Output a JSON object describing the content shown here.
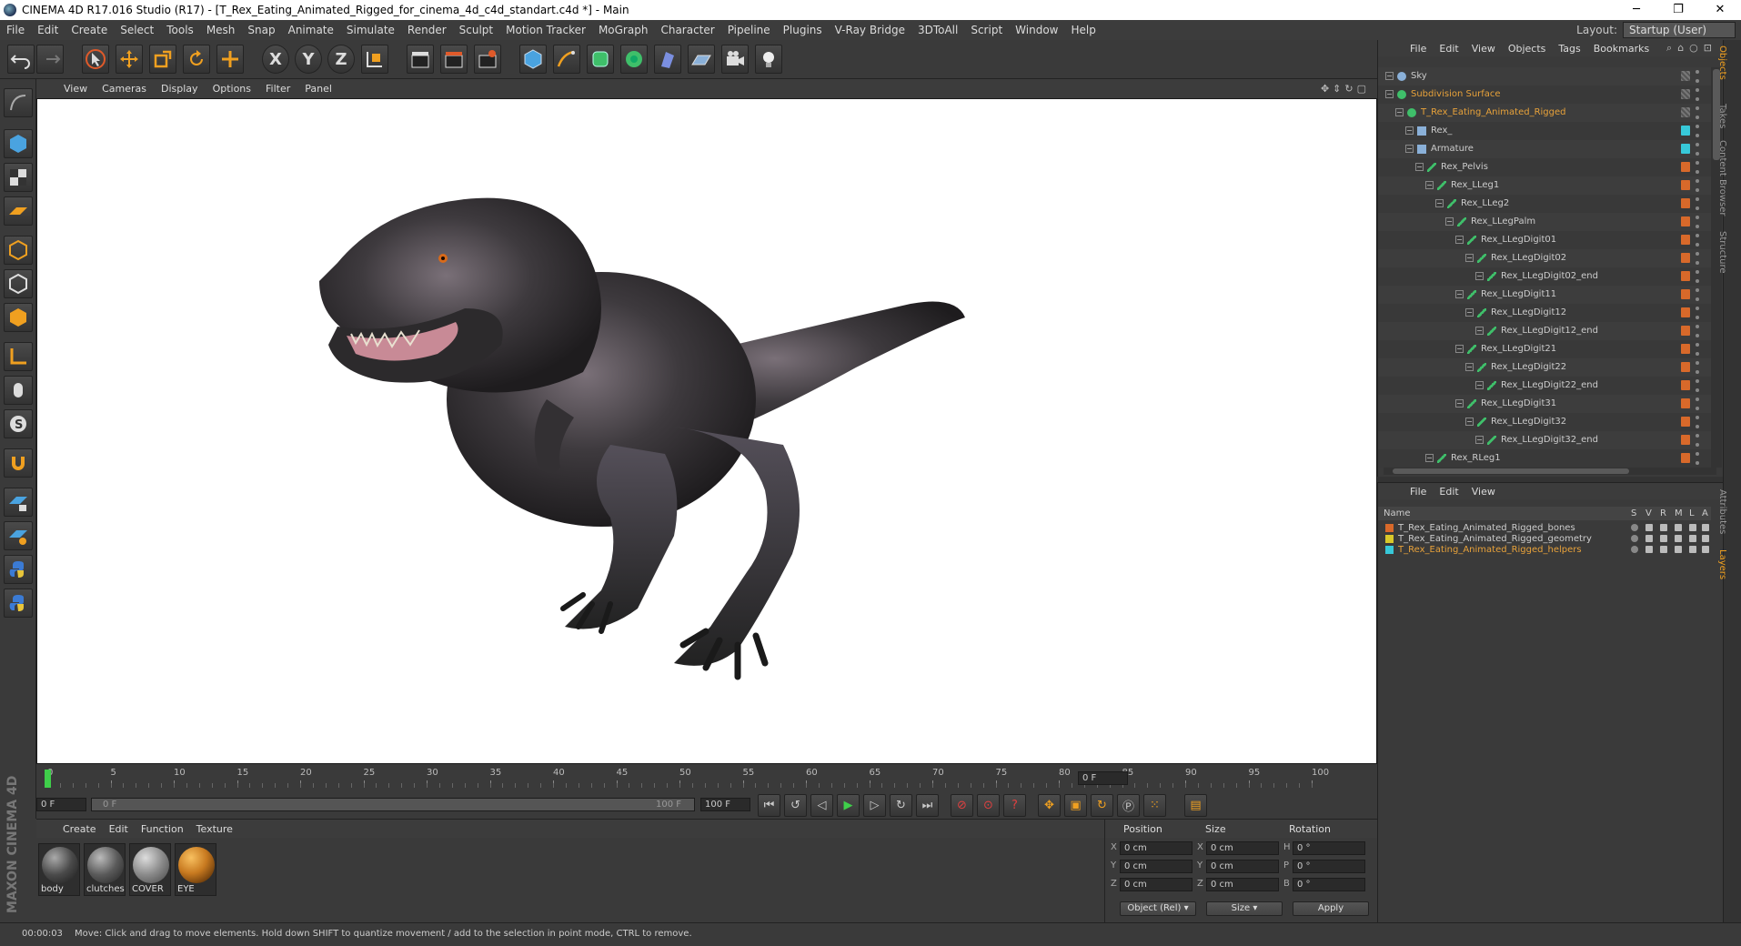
{
  "window": {
    "title": "CINEMA 4D R17.016 Studio (R17) - [T_Rex_Eating_Animated_Rigged_for_cinema_4d_c4d_standart.c4d *] - Main"
  },
  "menubar": {
    "items": [
      "File",
      "Edit",
      "Create",
      "Select",
      "Tools",
      "Mesh",
      "Snap",
      "Animate",
      "Simulate",
      "Sculpt",
      "Render",
      "Sculpt",
      "Motion Tracker",
      "MoGraph",
      "Character",
      "Pipeline",
      "Plugins",
      "V-Ray Bridge",
      "3DToAll",
      "Script",
      "Window",
      "Help"
    ],
    "layout_label": "Layout:",
    "layout_value": "Startup (User)"
  },
  "toolbar": {
    "axis_x": "X",
    "axis_y": "Y",
    "axis_z": "Z"
  },
  "viewport": {
    "menu": [
      "View",
      "Cameras",
      "Display",
      "Options",
      "Filter",
      "Panel"
    ]
  },
  "timeline": {
    "ticks": [
      "0",
      "5",
      "10",
      "15",
      "20",
      "25",
      "30",
      "35",
      "40",
      "45",
      "50",
      "55",
      "60",
      "65",
      "70",
      "75",
      "80",
      "85",
      "90",
      "95",
      "100"
    ],
    "current_frame": "0 F",
    "start_frame": "0 F",
    "range_start": "0 F",
    "range_end": "100 F",
    "end_frame": "100 F"
  },
  "materials": {
    "menu": [
      "Create",
      "Edit",
      "Function",
      "Texture"
    ],
    "items": [
      {
        "name": "body",
        "color": "#5a5a5a"
      },
      {
        "name": "clutches",
        "color": "#6a6a6a"
      },
      {
        "name": "COVER",
        "color": "#8a8a8a"
      },
      {
        "name": "EYE",
        "color": "#c87a20"
      }
    ]
  },
  "coords": {
    "headers": [
      "Position",
      "Size",
      "Rotation"
    ],
    "rows": [
      {
        "axis": "X",
        "pos": "0 cm",
        "saxis": "X",
        "size": "0 cm",
        "raxis": "H",
        "rot": "0 °"
      },
      {
        "axis": "Y",
        "pos": "0 cm",
        "saxis": "Y",
        "size": "0 cm",
        "raxis": "P",
        "rot": "0 °"
      },
      {
        "axis": "Z",
        "pos": "0 cm",
        "saxis": "Z",
        "size": "0 cm",
        "raxis": "B",
        "rot": "0 °"
      }
    ],
    "mode": "Object (Rel)",
    "size_mode": "Size",
    "apply": "Apply"
  },
  "objects": {
    "menu": [
      "File",
      "Edit",
      "View",
      "Objects",
      "Tags",
      "Bookmarks"
    ],
    "tree": [
      {
        "name": "Sky",
        "indent": 0,
        "color": "#cccccc",
        "tag": ""
      },
      {
        "name": "Subdivision Surface",
        "indent": 0,
        "color": "#e8a23a",
        "tag": ""
      },
      {
        "name": "T_Rex_Eating_Animated_Rigged",
        "indent": 1,
        "color": "#e8a23a",
        "tag": ""
      },
      {
        "name": "Rex_",
        "indent": 2,
        "color": "#cccccc",
        "tag": "#37c8d8"
      },
      {
        "name": "Armature",
        "indent": 2,
        "color": "#cccccc",
        "tag": "#37c8d8"
      },
      {
        "name": "Rex_Pelvis",
        "indent": 3,
        "color": "#cccccc",
        "tag": "#d8692a"
      },
      {
        "name": "Rex_LLeg1",
        "indent": 4,
        "color": "#cccccc",
        "tag": "#d8692a"
      },
      {
        "name": "Rex_LLeg2",
        "indent": 5,
        "color": "#cccccc",
        "tag": "#d8692a"
      },
      {
        "name": "Rex_LLegPalm",
        "indent": 6,
        "color": "#cccccc",
        "tag": "#d8692a"
      },
      {
        "name": "Rex_LLegDigit01",
        "indent": 7,
        "color": "#cccccc",
        "tag": "#d8692a"
      },
      {
        "name": "Rex_LLegDigit02",
        "indent": 8,
        "color": "#cccccc",
        "tag": "#d8692a"
      },
      {
        "name": "Rex_LLegDigit02_end",
        "indent": 9,
        "color": "#cccccc",
        "tag": "#d8692a"
      },
      {
        "name": "Rex_LLegDigit11",
        "indent": 7,
        "color": "#cccccc",
        "tag": "#d8692a"
      },
      {
        "name": "Rex_LLegDigit12",
        "indent": 8,
        "color": "#cccccc",
        "tag": "#d8692a"
      },
      {
        "name": "Rex_LLegDigit12_end",
        "indent": 9,
        "color": "#cccccc",
        "tag": "#d8692a"
      },
      {
        "name": "Rex_LLegDigit21",
        "indent": 7,
        "color": "#cccccc",
        "tag": "#d8692a"
      },
      {
        "name": "Rex_LLegDigit22",
        "indent": 8,
        "color": "#cccccc",
        "tag": "#d8692a"
      },
      {
        "name": "Rex_LLegDigit22_end",
        "indent": 9,
        "color": "#cccccc",
        "tag": "#d8692a"
      },
      {
        "name": "Rex_LLegDigit31",
        "indent": 7,
        "color": "#cccccc",
        "tag": "#d8692a"
      },
      {
        "name": "Rex_LLegDigit32",
        "indent": 8,
        "color": "#cccccc",
        "tag": "#d8692a"
      },
      {
        "name": "Rex_LLegDigit32_end",
        "indent": 9,
        "color": "#cccccc",
        "tag": "#d8692a"
      },
      {
        "name": "Rex_RLeg1",
        "indent": 4,
        "color": "#cccccc",
        "tag": "#d8692a"
      }
    ]
  },
  "layers": {
    "menu": [
      "File",
      "Edit",
      "View"
    ],
    "header_name": "Name",
    "header_cols": [
      "S",
      "V",
      "R",
      "M",
      "L",
      "A"
    ],
    "items": [
      {
        "name": "T_Rex_Eating_Animated_Rigged_bones",
        "color": "#d8692a",
        "text_color": "#cccccc"
      },
      {
        "name": "T_Rex_Eating_Animated_Rigged_geometry",
        "color": "#d8c82a",
        "text_color": "#cccccc"
      },
      {
        "name": "T_Rex_Eating_Animated_Rigged_helpers",
        "color": "#37c8d8",
        "text_color": "#e8a23a"
      }
    ]
  },
  "sidetabs": [
    "Objects",
    "Takes",
    "Content Browser",
    "Structure",
    "Attributes",
    "Layers"
  ],
  "status": {
    "time": "00:00:03",
    "message": "Move: Click and drag to move elements. Hold down SHIFT to quantize movement / add to the selection in point mode, CTRL to remove."
  },
  "branding": {
    "logo_text": "MAXON CINEMA 4D"
  }
}
